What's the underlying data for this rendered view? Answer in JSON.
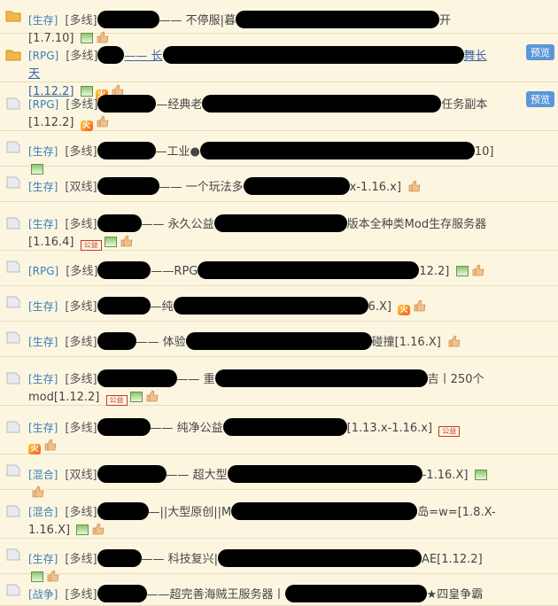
{
  "rows": [
    {
      "category": "[生存]",
      "network": "[多线]",
      "title_a": "—— 不停服|暮",
      "title_b": "开[1.7.10]",
      "icons": [
        "img",
        "like"
      ],
      "folder": "open"
    },
    {
      "category": "[RPG]",
      "network": "[多线]",
      "title_a": "—— 长",
      "title_b": "舞长天",
      "line2": "[1.12.2]",
      "icons2": [
        "img",
        "hot",
        "like"
      ],
      "preview": "预览",
      "folder": "open"
    },
    {
      "category": "[RPG]",
      "network": "[多线]",
      "title_a": "—经典老",
      "title_b": "任务副本",
      "line2": "[1.12.2]",
      "icons2": [
        "hot",
        "like"
      ],
      "preview": "预览",
      "folder": "page"
    },
    {
      "category": "[生存]",
      "network": "[多线]",
      "title_a": "—工业●",
      "title_b": "10]",
      "icons": [
        "img"
      ],
      "folder": "page"
    },
    {
      "category": "[生存]",
      "network": "[双线]",
      "title_a": "—— 一个玩法多",
      "title_b": "x-1.16.x]",
      "icons": [
        "like"
      ],
      "folder": "page"
    },
    {
      "category": "[生存]",
      "network": "[多线]",
      "title_a": "—— 永久公益",
      "title_b": "版本全种类Mod生存服务器",
      "line2": "[1.16.4]",
      "icons2": [
        "pub",
        "img",
        "like"
      ],
      "folder": "page"
    },
    {
      "category": "[RPG]",
      "network": "[多线]",
      "title_a": "——RPG",
      "title_b": "12.2]",
      "icons": [
        "img",
        "like"
      ],
      "folder": "page"
    },
    {
      "category": "[生存]",
      "network": "[多线]",
      "title_a": "—纯",
      "title_b": "6.X]",
      "icons": [
        "hot",
        "like"
      ],
      "folder": "page"
    },
    {
      "category": "[生存]",
      "network": "[多线]",
      "title_a": "—— 体验",
      "title_b": "碰撞[1.16.X]",
      "icons": [
        "like"
      ],
      "folder": "page"
    },
    {
      "category": "[生存]",
      "network": "[多线]",
      "title_a": "—— 重",
      "title_b": "吉丨250个",
      "line2": "mod[1.12.2]",
      "icons2": [
        "pub",
        "img",
        "like"
      ],
      "folder": "page"
    },
    {
      "category": "[生存]",
      "network": "[多线]",
      "title_a": "—— 纯净公益",
      "title_b": "[1.13.x-1.16.x]",
      "icons": [
        "pub"
      ],
      "icons2": [
        "hot",
        "like"
      ],
      "line2": "",
      "folder": "page"
    },
    {
      "category": "[混合]",
      "network": "[双线]",
      "title_a": "—— 超大型",
      "title_b": "-1.16.X]",
      "icons": [
        "img",
        "like"
      ],
      "folder": "page"
    },
    {
      "category": "[混合]",
      "network": "[多线]",
      "title_a": "—||大型原创||M",
      "title_b": "岛=w=[1.8.X-",
      "line2": "1.16.X]",
      "icons2": [
        "img",
        "like"
      ],
      "folder": "page"
    },
    {
      "category": "[生存]",
      "network": "[多线]",
      "title_a": "—— 科技复兴|",
      "title_b": "AE[1.12.2]",
      "icons": [
        "img",
        "like"
      ],
      "folder": "page"
    },
    {
      "category": "[战争]",
      "network": "[多线]",
      "title_a": "——超完善海贼王服务器丨",
      "title_b": "★四皇争霸",
      "folder": "page"
    }
  ],
  "icon_text": {
    "hot": "火",
    "pub": "公益"
  },
  "colors": {
    "category": "#3a7fb8",
    "preview_bg": "#5b96d9",
    "background": "#fcf6e1"
  }
}
